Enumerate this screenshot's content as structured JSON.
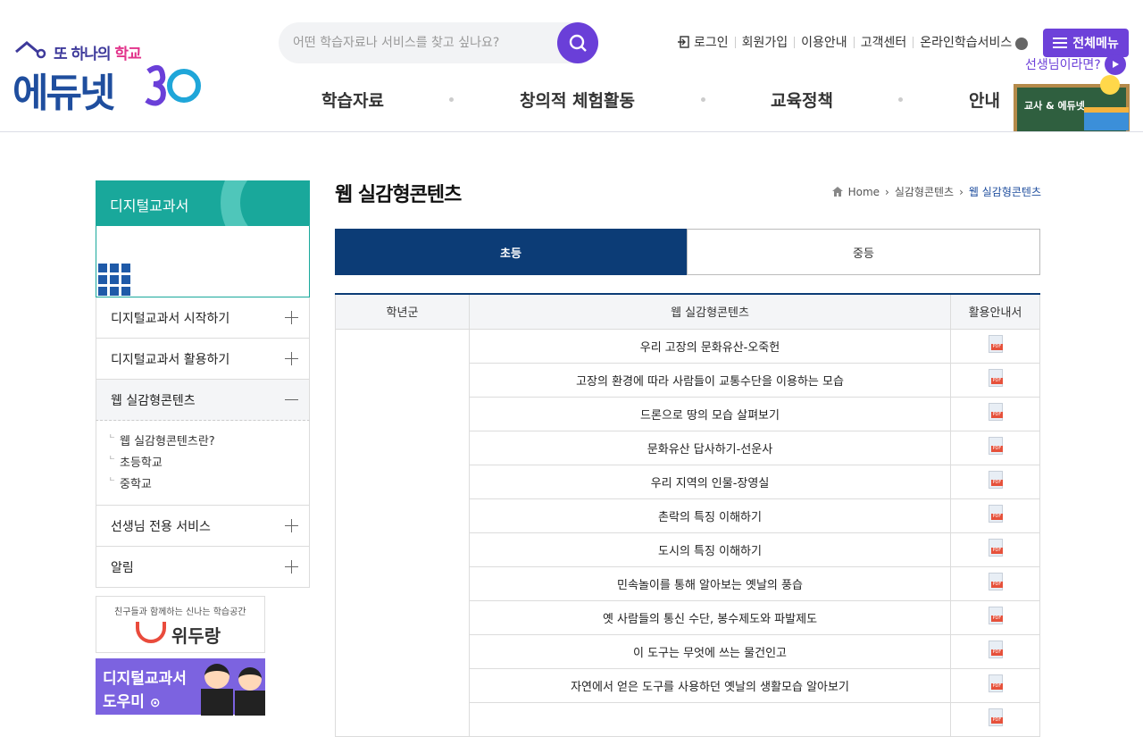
{
  "header": {
    "logo_tagline_pre": "또 하나의",
    "logo_tagline_em": "학교",
    "logo_name": "에듀넷",
    "search_placeholder": "어떤 학습자료나 서비스를 찾고 싶나요?",
    "util_links": [
      "로그인",
      "회원가입",
      "이용안내",
      "고객센터",
      "온라인학습서비스"
    ],
    "all_menu": "전체메뉴",
    "teacher_link": "선생님이라면?",
    "board_text": "교사 & 에듀넷",
    "gnb": [
      "학습자료",
      "창의적 체험활동",
      "교육정책",
      "안내"
    ]
  },
  "sidebar": {
    "title": "디지털교과서",
    "items": [
      {
        "label": "디지털교과서 시작하기"
      },
      {
        "label": "디지털교과서 활용하기"
      },
      {
        "label": "웹 실감형콘텐츠"
      },
      {
        "label": "선생님 전용 서비스"
      },
      {
        "label": "알림"
      }
    ],
    "subitems": [
      "웹 실감형콘텐츠란?",
      "초등학교",
      "중학교"
    ],
    "banner1_tagline": "친구들과 함께하는 신나는 학습공간",
    "banner1_name": "위두랑",
    "banner2_line1": "디지털교과서",
    "banner2_line2": "도우미"
  },
  "main": {
    "title": "웹 실감형콘텐츠",
    "breadcrumb": [
      "Home",
      "실감형콘텐츠",
      "웹 실감형콘텐츠"
    ],
    "tabs": [
      "초등",
      "중등"
    ],
    "table": {
      "headers": [
        "학년군",
        "웹 실감형콘텐츠",
        "활용안내서"
      ],
      "rows": [
        "우리 고장의 문화유산-오죽헌",
        "고장의 환경에 따라 사람들이 교통수단을 이용하는 모습",
        "드론으로 땅의 모습 살펴보기",
        "문화유산 답사하기-선운사",
        "우리 지역의 인물-장영실",
        "촌락의 특징 이해하기",
        "도시의 특징 이해하기",
        "민속놀이를 통해 알아보는 옛날의 풍습",
        "옛 사람들의 통신 수단, 봉수제도와 파발제도",
        "이 도구는 무엇에 쓰는 물건인고",
        "자연에서 얻은 도구를 사용하던 옛날의 생활모습 알아보기"
      ]
    }
  }
}
